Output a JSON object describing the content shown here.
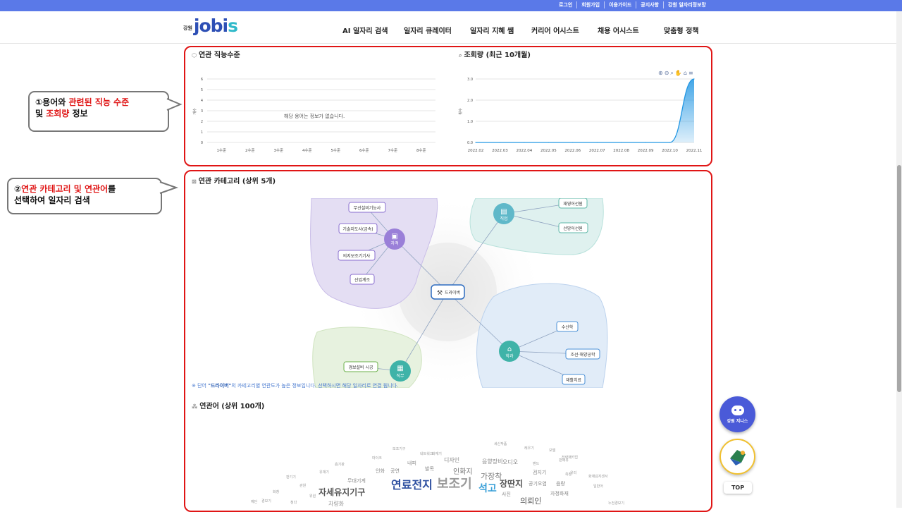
{
  "top_links": [
    "로그인",
    "회원가입",
    "이용가이드",
    "공지사항",
    "강원 일자리정보망"
  ],
  "logo": {
    "region": "강원",
    "word_a": "jobi",
    "word_b": "s"
  },
  "nav": [
    "AI 일자리 검색",
    "일자리 큐레이터",
    "일자리 지혜 쌤",
    "커리어 어시스트",
    "채용 어시스트",
    "맞춤형 정책"
  ],
  "callouts": [
    {
      "circle": "①",
      "line1_a": "용어와 ",
      "line1_red": "관련된 직능 수준",
      "line2_a": "및 ",
      "line2_red": "조회량",
      "line2_b": " 정보"
    },
    {
      "circle": "②",
      "line1_red": "연관 카테고리 및 연관어",
      "line1_b": "를",
      "line2": "선택하여 일자리 검색"
    }
  ],
  "skill_chart": {
    "title": "연관 직능수준",
    "ylabel": "개수",
    "y_ticks": [
      "0",
      "1",
      "2",
      "3",
      "4",
      "5",
      "6"
    ],
    "x_ticks": [
      "1수준",
      "2수준",
      "3수준",
      "4수준",
      "5수준",
      "6수준",
      "7수준",
      "8수준"
    ],
    "empty_message": "해당 용어는 정보가 없습니다."
  },
  "view_chart": {
    "title": "조회량 (최근 10개월)",
    "ylabel": "횟수",
    "toolbar_icons": [
      "zoom-in-icon",
      "zoom-out-icon",
      "magnifier-icon",
      "pan-icon",
      "home-icon",
      "menu-icon"
    ]
  },
  "chart_data": [
    {
      "type": "bar",
      "title": "연관 직능수준",
      "categories": [
        "1수준",
        "2수준",
        "3수준",
        "4수준",
        "5수준",
        "6수준",
        "7수준",
        "8수준"
      ],
      "values": [],
      "ylabel": "개수",
      "ylim": [
        0,
        6
      ]
    },
    {
      "type": "area",
      "title": "조회량 (최근 10개월)",
      "x": [
        "2022.02",
        "2022.03",
        "2022.04",
        "2022.05",
        "2022.06",
        "2022.07",
        "2022.08",
        "2022.09",
        "2022.10",
        "2022.11"
      ],
      "values": [
        0,
        0,
        0,
        0,
        0,
        0,
        0,
        0,
        0,
        3
      ],
      "y_ticks": [
        "0.0",
        "1.0",
        "2.0",
        "3.0"
      ],
      "ylabel": "횟수",
      "ylim": [
        0,
        3
      ],
      "color": "#2196e3"
    }
  ],
  "category": {
    "title": "연관 카테고리 (상위 5개)",
    "center": "드라이버",
    "groups": [
      {
        "name": "자격",
        "color": "#9a7fd8",
        "items": [
          "무선설비기능사",
          "기술지도사(금속)",
          "의지보조기기사",
          "산업계조"
        ]
      },
      {
        "name": "직업",
        "color": "#5fb8c9",
        "items": [
          "재영어선원",
          "선망어선원"
        ]
      },
      {
        "name": "학과",
        "color": "#3fb3a8",
        "items": [
          "수산학",
          "조선·해양공학",
          "재활치료"
        ]
      },
      {
        "name": "직무",
        "color": "#3fb3a8",
        "items": [
          "경보설비 시공"
        ]
      }
    ],
    "note_prefix": "※ 단어 ",
    "note_word": "\"드라이버\"",
    "note_suffix": "의 카테고리별 연관도가 높은 정보입니다. 선택하시면 해당 일자리로 연결 됩니다."
  },
  "related_words": {
    "title": "연관어 (상위 100개)",
    "words": [
      {
        "t": "연료전지",
        "s": 16,
        "c": "#2d4fa0"
      },
      {
        "t": "보조기",
        "s": 18,
        "c": "#9a9a9a"
      },
      {
        "t": "자세유지기구",
        "s": 12,
        "c": "#555"
      },
      {
        "t": "석고",
        "s": 14,
        "c": "#3aa0d8"
      },
      {
        "t": "장딴지",
        "s": 12,
        "c": "#555"
      },
      {
        "t": "가장착",
        "s": 11,
        "c": "#777"
      },
      {
        "t": "인화지",
        "s": 10,
        "c": "#777"
      },
      {
        "t": "의뢰인",
        "s": 11,
        "c": "#555"
      },
      {
        "t": "음향장비",
        "s": 8,
        "c": "#888"
      },
      {
        "t": "오디오",
        "s": 8,
        "c": "#888"
      },
      {
        "t": "디자인",
        "s": 8,
        "c": "#888"
      },
      {
        "t": "내피",
        "s": 7,
        "c": "#888"
      },
      {
        "t": "발목",
        "s": 7,
        "c": "#888"
      },
      {
        "t": "인화",
        "s": 7,
        "c": "#888"
      },
      {
        "t": "공연",
        "s": 7,
        "c": "#888"
      },
      {
        "t": "무대기계",
        "s": 7,
        "c": "#888"
      },
      {
        "t": "검지기",
        "s": 7,
        "c": "#888"
      },
      {
        "t": "공기오염",
        "s": 7,
        "c": "#888"
      },
      {
        "t": "음량",
        "s": 7,
        "c": "#888"
      },
      {
        "t": "자정화재",
        "s": 7,
        "c": "#888"
      },
      {
        "t": "사진",
        "s": 7,
        "c": "#888"
      },
      {
        "t": "차량화",
        "s": 8,
        "c": "#999"
      },
      {
        "t": "보조기구",
        "s": 5,
        "c": "#999"
      },
      {
        "t": "네트워크",
        "s": 5,
        "c": "#999"
      },
      {
        "t": "화재기",
        "s": 5,
        "c": "#999"
      },
      {
        "t": "세신작품",
        "s": 5,
        "c": "#999"
      },
      {
        "t": "레우기",
        "s": 5,
        "c": "#999"
      },
      {
        "t": "모델",
        "s": 5,
        "c": "#999"
      },
      {
        "t": "판매유",
        "s": 5,
        "c": "#999"
      },
      {
        "t": "전략패키업",
        "s": 5,
        "c": "#999"
      },
      {
        "t": "유리",
        "s": 5,
        "c": "#999"
      },
      {
        "t": "측정",
        "s": 5,
        "c": "#999"
      },
      {
        "t": "화재감지센서",
        "s": 5,
        "c": "#999"
      },
      {
        "t": "일반어",
        "s": 5,
        "c": "#999"
      },
      {
        "t": "마이크",
        "s": 5,
        "c": "#999"
      },
      {
        "t": "누전경보기",
        "s": 5,
        "c": "#999"
      },
      {
        "t": "흡기판",
        "s": 5,
        "c": "#999"
      },
      {
        "t": "유재기",
        "s": 5,
        "c": "#999"
      },
      {
        "t": "판기기",
        "s": 5,
        "c": "#999"
      },
      {
        "t": "관원",
        "s": 5,
        "c": "#999"
      },
      {
        "t": "화창",
        "s": 5,
        "c": "#999"
      },
      {
        "t": "청다",
        "s": 5,
        "c": "#999"
      },
      {
        "t": "경보기",
        "s": 5,
        "c": "#999"
      },
      {
        "t": "예단",
        "s": 5,
        "c": "#999"
      },
      {
        "t": "밴드",
        "s": 5,
        "c": "#999"
      },
      {
        "t": "위원",
        "s": 5,
        "c": "#999"
      }
    ]
  },
  "float_buttons": {
    "assistant": "강원 지니스",
    "top": "TOP"
  }
}
